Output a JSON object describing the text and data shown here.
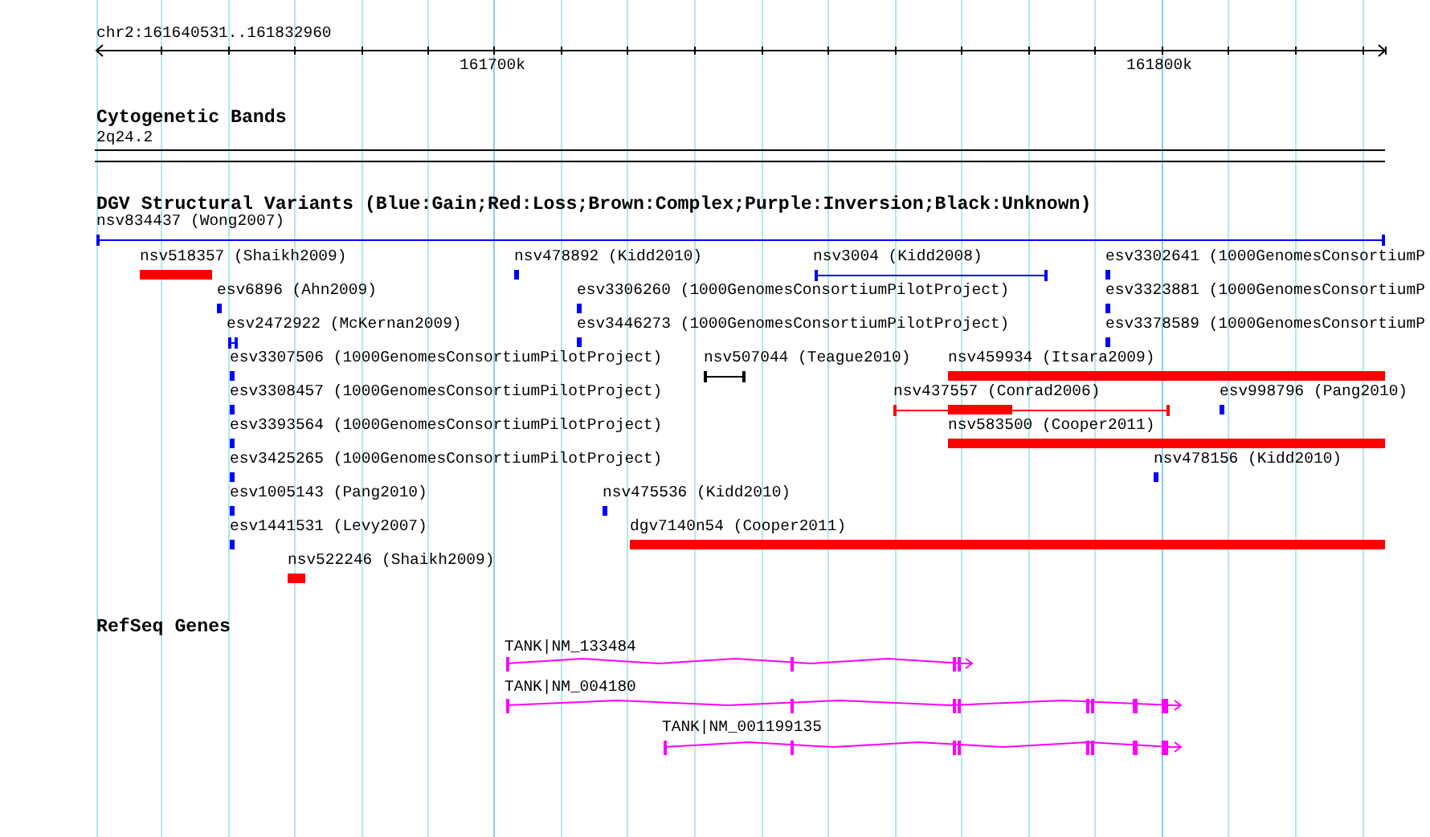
{
  "ruler": {
    "range": "chr2:161640531..161832960",
    "tick_labels": [
      "161700k",
      "161800k"
    ]
  },
  "cytoband": {
    "title": "Cytogenetic Bands",
    "band": "2q24.2"
  },
  "dgv": {
    "title": "DGV Structural Variants (Blue:Gain;Red:Loss;Brown:Complex;Purple:Inversion;Black:Unknown)",
    "features": [
      {
        "name": "nsv834437 (Wong2007)",
        "kind": "span",
        "color": "#0000ff"
      },
      {
        "name": "nsv518357 (Shaikh2009)",
        "kind": "block",
        "color": "#ff0000"
      },
      {
        "name": "nsv478892 (Kidd2010)",
        "kind": "block",
        "color": "#0000ff"
      },
      {
        "name": "nsv3004 (Kidd2008)",
        "kind": "span",
        "color": "#0000ff"
      },
      {
        "name": "esv3302641 (1000GenomesConsortiumP",
        "kind": "block",
        "color": "#0000ff"
      },
      {
        "name": "esv6896 (Ahn2009)",
        "kind": "block",
        "color": "#0000ff"
      },
      {
        "name": "esv3306260 (1000GenomesConsortiumPilotProject)",
        "kind": "block",
        "color": "#0000ff"
      },
      {
        "name": "esv3323881 (1000GenomesConsortiumP",
        "kind": "block",
        "color": "#0000ff"
      },
      {
        "name": "esv2472922 (McKernan2009)",
        "kind": "span",
        "color": "#0000ff"
      },
      {
        "name": "esv3446273 (1000GenomesConsortiumPilotProject)",
        "kind": "block",
        "color": "#0000ff"
      },
      {
        "name": "esv3378589 (1000GenomesConsortiumP",
        "kind": "block",
        "color": "#0000ff"
      },
      {
        "name": "esv3307506 (1000GenomesConsortiumPilotProject)",
        "kind": "block",
        "color": "#0000ff"
      },
      {
        "name": "nsv507044 (Teague2010)",
        "kind": "span",
        "color": "#000000"
      },
      {
        "name": "nsv459934 (Itsara2009)",
        "kind": "block",
        "color": "#ff0000"
      },
      {
        "name": "esv3308457 (1000GenomesConsortiumPilotProject)",
        "kind": "block",
        "color": "#0000ff"
      },
      {
        "name": "nsv437557 (Conrad2006)",
        "kind": "mixed",
        "color": "#ff0000"
      },
      {
        "name": "esv998796 (Pang2010)",
        "kind": "block",
        "color": "#0000ff"
      },
      {
        "name": "esv3393564 (1000GenomesConsortiumPilotProject)",
        "kind": "block",
        "color": "#0000ff"
      },
      {
        "name": "nsv583500 (Cooper2011)",
        "kind": "block",
        "color": "#ff0000"
      },
      {
        "name": "esv3425265 (1000GenomesConsortiumPilotProject)",
        "kind": "block",
        "color": "#0000ff"
      },
      {
        "name": "nsv478156 (Kidd2010)",
        "kind": "block",
        "color": "#0000ff"
      },
      {
        "name": "esv1005143 (Pang2010)",
        "kind": "block",
        "color": "#0000ff"
      },
      {
        "name": "nsv475536 (Kidd2010)",
        "kind": "block",
        "color": "#0000ff"
      },
      {
        "name": "esv1441531 (Levy2007)",
        "kind": "block",
        "color": "#0000ff"
      },
      {
        "name": "dgv7140n54 (Cooper2011)",
        "kind": "block",
        "color": "#ff0000"
      },
      {
        "name": "nsv522246 (Shaikh2009)",
        "kind": "block",
        "color": "#ff0000"
      }
    ]
  },
  "genes": {
    "title": "RefSeq Genes",
    "features": [
      {
        "name": "TANK|NM_133484"
      },
      {
        "name": "TANK|NM_004180"
      },
      {
        "name": "TANK|NM_001199135"
      }
    ]
  }
}
